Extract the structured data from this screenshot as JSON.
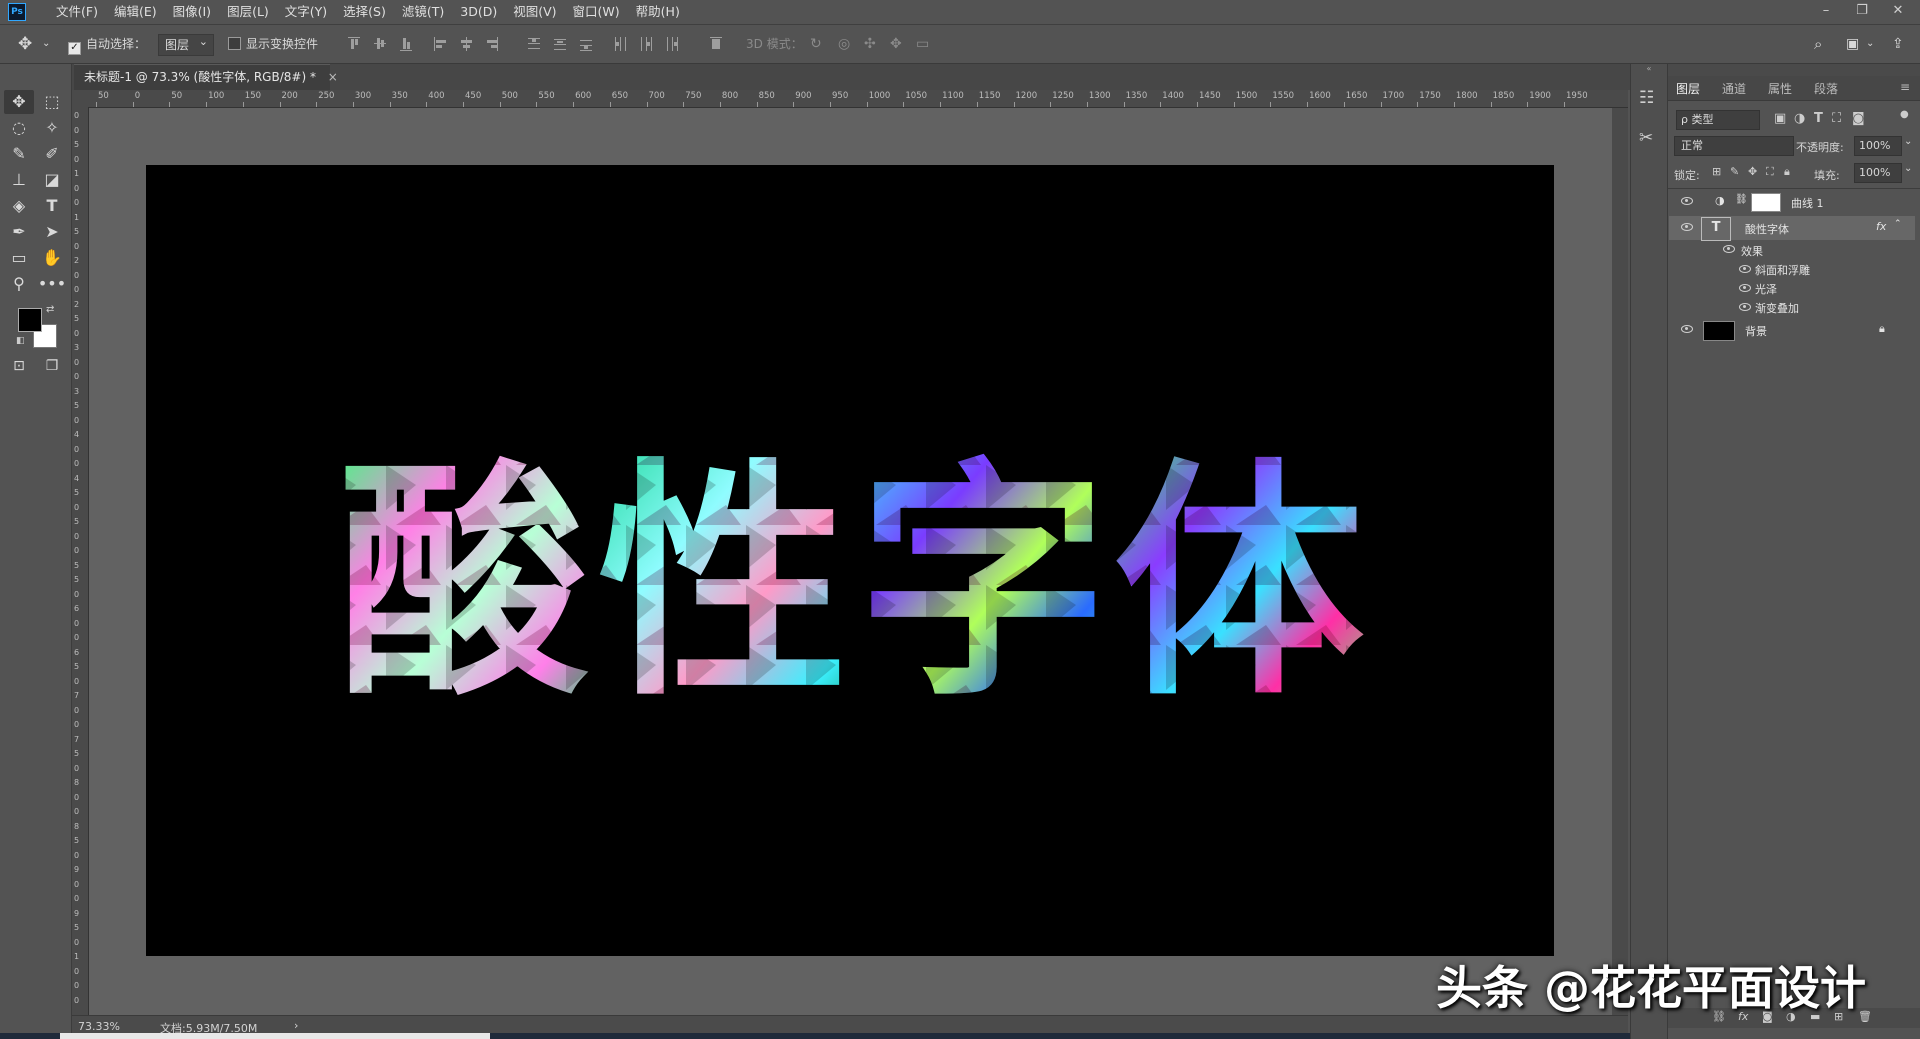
{
  "app": {
    "logo": "Ps",
    "menu": [
      "文件(F)",
      "编辑(E)",
      "图像(I)",
      "图层(L)",
      "文字(Y)",
      "选择(S)",
      "滤镜(T)",
      "3D(D)",
      "视图(V)",
      "窗口(W)",
      "帮助(H)"
    ]
  },
  "options": {
    "auto_select_label": "自动选择：",
    "auto_select_value": "图层",
    "show_transform_label": "显示变换控件",
    "mode_3d_label": "3D 模式："
  },
  "document": {
    "tab_title": "未标题-1 @ 73.3% (酸性字体, RGB/8#) *",
    "close": "×",
    "ruler_top": [
      "50",
      "0",
      "50",
      "100",
      "150",
      "200",
      "250",
      "300",
      "350",
      "400",
      "450",
      "500",
      "550",
      "600",
      "650",
      "700",
      "750",
      "800",
      "850",
      "900",
      "950",
      "1000",
      "1050",
      "1100",
      "1150",
      "1200",
      "1250",
      "1300",
      "1350",
      "1400",
      "1450",
      "1500",
      "1550",
      "1600",
      "1650",
      "1700",
      "1750",
      "1800",
      "1850",
      "1900",
      "1950"
    ],
    "ruler_left": [
      "0",
      "0",
      "5",
      "0",
      "1",
      "0",
      "0",
      "1",
      "5",
      "0",
      "2",
      "0",
      "0",
      "2",
      "5",
      "0",
      "3",
      "0",
      "0",
      "3",
      "5",
      "0",
      "4",
      "0",
      "0",
      "4",
      "5",
      "0",
      "5",
      "0",
      "0",
      "5",
      "5",
      "0",
      "6",
      "0",
      "0",
      "6",
      "5",
      "0",
      "7",
      "0",
      "0",
      "7",
      "5",
      "0",
      "8",
      "0",
      "0",
      "8",
      "5",
      "0",
      "9",
      "0",
      "0",
      "9",
      "5",
      "0",
      "1",
      "0",
      "0",
      "0"
    ],
    "canvas_text": [
      "酸",
      "性",
      "字",
      "体"
    ],
    "zoom": "73.33%",
    "doc_info": "文档:5.93M/7.50M",
    "status_arrow": "›"
  },
  "panel": {
    "tabs": [
      "图层",
      "通道",
      "属性",
      "段落"
    ],
    "filter_kind": "ρ 类型",
    "blend_mode": "正常",
    "opacity_label": "不透明度:",
    "opacity_value": "100%",
    "lock_label": "锁定:",
    "fill_label": "填充:",
    "fill_value": "100%",
    "layers": {
      "curves": "曲线 1",
      "text_layer": "酸性字体",
      "fx": "fx",
      "effects": "效果",
      "effect_1": "斜面和浮雕",
      "effect_2": "光泽",
      "effect_3": "渐变叠加",
      "background": "背景"
    }
  },
  "watermark": "头条 @花花平面设计",
  "colors": {
    "ui_bg": "#535353",
    "canvas_bg": "#000000",
    "accent": "#31a8ff"
  }
}
